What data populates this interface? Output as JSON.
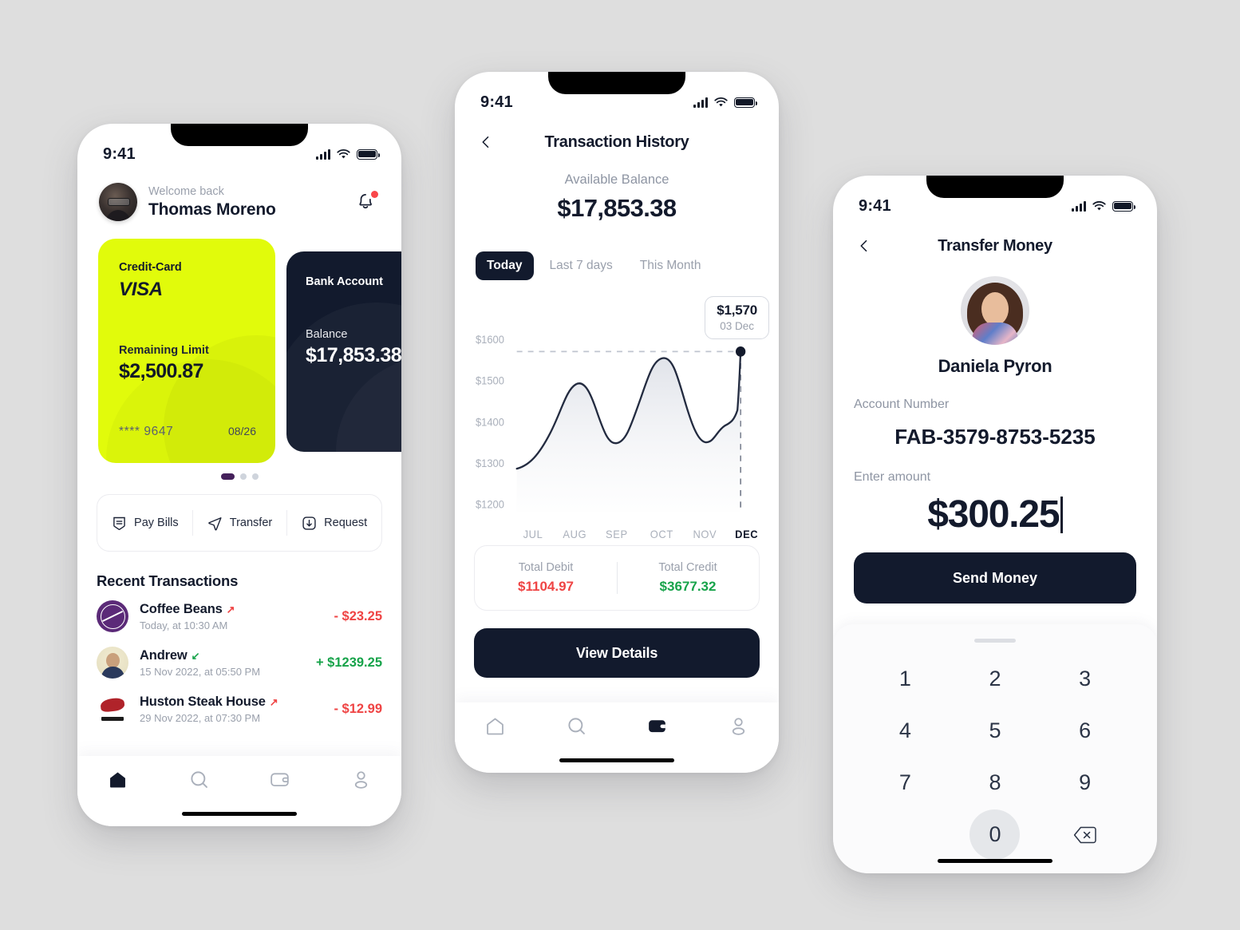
{
  "background_color": "#dedede",
  "accent": {
    "yellow": "#e1fb0b",
    "dark": "#121a2d",
    "red": "#ef4444",
    "green": "#17a34a"
  },
  "status_bar": {
    "time": "9:41",
    "signal_icon": "cellular-bars-icon",
    "wifi_icon": "wifi-icon",
    "battery_icon": "battery-full-icon"
  },
  "home_screen": {
    "header": {
      "welcome": "Welcome back",
      "user_name": "Thomas Moreno",
      "avatar_icon": "user-avatar",
      "notification_icon": "bell-icon"
    },
    "cards": [
      {
        "type_label": "Credit-Card",
        "brand": "VISA",
        "limit_label": "Remaining Limit",
        "amount": "$2,500.87",
        "masked_number": "**** 9647",
        "expiry": "08/26"
      },
      {
        "type_label": "Bank Account",
        "balance_label": "Balance",
        "amount": "$17,853.38"
      }
    ],
    "carousel_dots": 3,
    "carousel_active_index": 0,
    "actions": [
      {
        "label": "Pay Bills",
        "icon": "bill-shield-icon"
      },
      {
        "label": "Transfer",
        "icon": "send-plane-icon"
      },
      {
        "label": "Request",
        "icon": "download-box-icon"
      }
    ],
    "transactions_title": "Recent Transactions",
    "transactions": [
      {
        "name": "Coffee Beans",
        "date": "Today, at 10:30 AM",
        "amount": "- $23.25",
        "direction": "out",
        "icon": "coffee-bean-tea-leaf-logo"
      },
      {
        "name": "Andrew",
        "date": "15 Nov 2022, at 05:50 PM",
        "amount": "+ $1239.25",
        "direction": "in",
        "icon": "andrew-avatar"
      },
      {
        "name": "Huston Steak House",
        "date": "29 Nov 2022, at 07:30 PM",
        "amount": "- $12.99",
        "direction": "out",
        "icon": "huston-bull-logo"
      }
    ],
    "bottom_nav": [
      {
        "icon": "home-icon",
        "active": true
      },
      {
        "icon": "search-icon",
        "active": false
      },
      {
        "icon": "wallet-icon",
        "active": false
      },
      {
        "icon": "profile-icon",
        "active": false
      }
    ]
  },
  "history_screen": {
    "back_icon": "chevron-left-icon",
    "title": "Transaction History",
    "available_balance_label": "Available Balance",
    "available_balance": "$17,853.38",
    "segments": [
      {
        "label": "Today",
        "active": true
      },
      {
        "label": "Last 7 days",
        "active": false
      },
      {
        "label": "This Month",
        "active": false
      }
    ],
    "tooltip": {
      "value": "$1,570",
      "date": "03 Dec"
    },
    "totals": [
      {
        "label": "Total Debit",
        "value": "$1104.97",
        "tone": "neg"
      },
      {
        "label": "Total Credit",
        "value": "$3677.32",
        "tone": "pos"
      }
    ],
    "view_details_label": "View Details",
    "bottom_nav": [
      {
        "icon": "home-icon",
        "active": false
      },
      {
        "icon": "search-icon",
        "active": false
      },
      {
        "icon": "wallet-icon",
        "active": true
      },
      {
        "icon": "profile-icon",
        "active": false
      }
    ]
  },
  "chart_data": {
    "type": "area",
    "title": "",
    "xlabel": "",
    "ylabel": "",
    "categories": [
      "JUL",
      "AUG",
      "SEP",
      "OCT",
      "NOV",
      "DEC"
    ],
    "x_tick_labels": [
      "JUL",
      "AUG",
      "SEP",
      "OCT",
      "NOV",
      "DEC"
    ],
    "active_x_tick": "DEC",
    "y_tick_labels": [
      "$1600",
      "$1500",
      "$1400",
      "$1300",
      "$1200"
    ],
    "ylim": [
      1200,
      1600
    ],
    "grid": false,
    "legend": null,
    "highlight_point": {
      "x": "DEC",
      "y": 1570,
      "label": "$1,570",
      "date": "03 Dec"
    },
    "reference_line_y": 1570,
    "values": [
      1275,
      1467,
      1358,
      1572,
      1358,
      1570
    ],
    "series": [
      {
        "name": "Balance",
        "values": [
          1275,
          1467,
          1358,
          1572,
          1358,
          1570
        ]
      }
    ],
    "dense_points": [
      {
        "x": 0.0,
        "y": 1275
      },
      {
        "x": 0.3,
        "y": 1292
      },
      {
        "x": 0.7,
        "y": 1380
      },
      {
        "x": 1.0,
        "y": 1467
      },
      {
        "x": 1.35,
        "y": 1400
      },
      {
        "x": 1.7,
        "y": 1358
      },
      {
        "x": 2.1,
        "y": 1370
      },
      {
        "x": 2.6,
        "y": 1500
      },
      {
        "x": 3.0,
        "y": 1572
      },
      {
        "x": 3.45,
        "y": 1520
      },
      {
        "x": 3.9,
        "y": 1380
      },
      {
        "x": 4.2,
        "y": 1358
      },
      {
        "x": 4.6,
        "y": 1398
      },
      {
        "x": 5.0,
        "y": 1405
      },
      {
        "x": 5.5,
        "y": 1440
      },
      {
        "x": 6.0,
        "y": 1570
      }
    ]
  },
  "transfer_screen": {
    "back_icon": "chevron-left-icon",
    "title": "Transfer Money",
    "recipient_name": "Daniela Pyron",
    "recipient_avatar_icon": "daniela-avatar",
    "account_label": "Account Number",
    "account_number": "FAB-3579-8753-5235",
    "amount_label": "Enter amount",
    "amount_value": "$300.25",
    "send_label": "Send Money",
    "keypad": [
      "1",
      "2",
      "3",
      "4",
      "5",
      "6",
      "7",
      "8",
      "9"
    ],
    "keypad_zero": "0",
    "keypad_delete_icon": "backspace-icon"
  }
}
